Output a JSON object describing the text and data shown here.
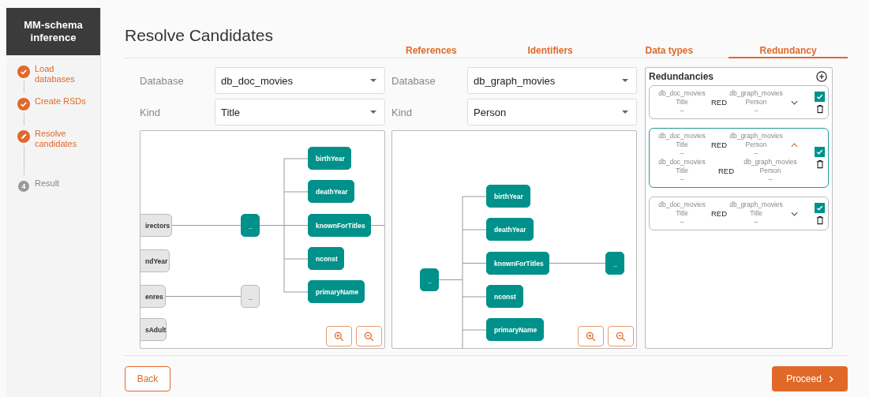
{
  "app": {
    "title": "MM-schema inference"
  },
  "steps": [
    {
      "label": "Load databases",
      "kind": "done"
    },
    {
      "label": "Create RSDs",
      "kind": "done"
    },
    {
      "label": "Resolve candidates",
      "kind": "active"
    },
    {
      "label": "Result",
      "kind": "pending",
      "number": "4"
    }
  ],
  "page_title": "Resolve Candidates",
  "tabs": [
    {
      "label": "References",
      "selected": false
    },
    {
      "label": "Identifiers",
      "selected": false
    },
    {
      "label": "Data types",
      "selected": false
    },
    {
      "label": "Redundancy",
      "selected": true
    }
  ],
  "panels": [
    {
      "database_label": "Database",
      "database": "db_doc_movies",
      "kind_label": "Kind",
      "kind": "Title",
      "nodes": [
        {
          "label": "irectors",
          "highlighted": false
        },
        {
          "label": "ndYear",
          "highlighted": false
        },
        {
          "label": "enres",
          "highlighted": false
        },
        {
          "label": "sAdult",
          "highlighted": false
        },
        {
          "label": "_",
          "highlighted": true
        },
        {
          "label": "_",
          "highlighted": false
        },
        {
          "label": "birthYear",
          "highlighted": true
        },
        {
          "label": "deathYear",
          "highlighted": true
        },
        {
          "label": "knownForTitles",
          "highlighted": true
        },
        {
          "label": "nconst",
          "highlighted": true
        },
        {
          "label": "primaryName",
          "highlighted": true
        }
      ]
    },
    {
      "database_label": "Database",
      "database": "db_graph_movies",
      "kind_label": "Kind",
      "kind": "Person",
      "nodes": [
        {
          "label": "_",
          "highlighted": true
        },
        {
          "label": "birthYear",
          "highlighted": true
        },
        {
          "label": "deathYear",
          "highlighted": true
        },
        {
          "label": "knownForTitles",
          "highlighted": true
        },
        {
          "label": "nconst",
          "highlighted": true
        },
        {
          "label": "primaryName",
          "highlighted": true
        },
        {
          "label": "_",
          "highlighted": true
        }
      ]
    }
  ],
  "redundancies": {
    "title": "Redundancies",
    "items": [
      {
        "expanded": false,
        "checked": true,
        "pairs": [
          {
            "left_db": "db_doc_movies",
            "left_kind": "Title",
            "left_value": "–",
            "relation": "RED",
            "right_db": "db_graph_movies",
            "right_kind": "Person",
            "right_value": "–"
          }
        ]
      },
      {
        "expanded": true,
        "checked": true,
        "pairs": [
          {
            "left_db": "db_doc_movies",
            "left_kind": "Title",
            "left_value": "–",
            "relation": "RED",
            "right_db": "db_graph_movies",
            "right_kind": "Person",
            "right_value": "–"
          },
          {
            "left_db": "db_doc_movies",
            "left_kind": "Title",
            "left_value": "–",
            "relation": "RED",
            "right_db": "db_graph_movies",
            "right_kind": "Person",
            "right_value": "–"
          }
        ]
      },
      {
        "expanded": false,
        "checked": true,
        "pairs": [
          {
            "left_db": "db_doc_movies",
            "left_kind": "Title",
            "left_value": "–",
            "relation": "RED",
            "right_db": "db_graph_movies",
            "right_kind": "Title",
            "right_value": "–"
          }
        ]
      }
    ]
  },
  "back_button": "Back",
  "proceed_button": "Proceed"
}
